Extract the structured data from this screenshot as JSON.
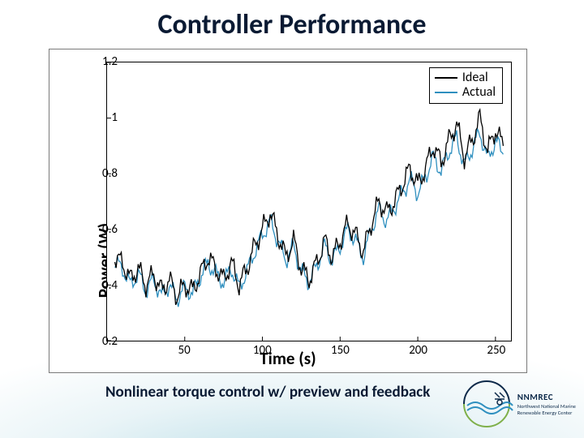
{
  "title": "Controller Performance",
  "subtitle": "Nonlinear torque control w/ preview and feedback",
  "logo": {
    "acronym": "NNMREC",
    "line1": "Northwest National Marine",
    "line2": "Renewable Energy Center"
  },
  "chart_data": {
    "type": "line",
    "xlabel": "Time (s)",
    "ylabel": "Power (W)",
    "xlim": [
      0,
      260
    ],
    "ylim": [
      0.2,
      1.2
    ],
    "xticks": [
      50,
      100,
      150,
      200,
      250
    ],
    "yticks": [
      0.2,
      0.4,
      0.6,
      0.8,
      1.0,
      1.2
    ],
    "legend_position": "top-right",
    "series": [
      {
        "name": "Ideal",
        "color": "#000000",
        "x": [
          5,
          10,
          15,
          20,
          25,
          30,
          35,
          40,
          45,
          50,
          55,
          60,
          65,
          70,
          75,
          80,
          85,
          90,
          95,
          100,
          105,
          110,
          115,
          120,
          125,
          130,
          135,
          140,
          145,
          150,
          155,
          160,
          165,
          170,
          175,
          180,
          185,
          190,
          195,
          200,
          205,
          210,
          215,
          220,
          225,
          230,
          235,
          240,
          245,
          250,
          255
        ],
        "values": [
          0.5,
          0.48,
          0.42,
          0.46,
          0.4,
          0.44,
          0.38,
          0.42,
          0.36,
          0.4,
          0.38,
          0.44,
          0.5,
          0.46,
          0.42,
          0.48,
          0.4,
          0.46,
          0.54,
          0.6,
          0.66,
          0.58,
          0.5,
          0.56,
          0.46,
          0.42,
          0.48,
          0.56,
          0.5,
          0.56,
          0.62,
          0.58,
          0.52,
          0.62,
          0.7,
          0.66,
          0.7,
          0.76,
          0.82,
          0.76,
          0.82,
          0.9,
          0.84,
          0.92,
          0.98,
          0.86,
          0.92,
          1.0,
          0.88,
          0.96,
          0.9
        ]
      },
      {
        "name": "Actual",
        "color": "#2e8fbf",
        "x": [
          5,
          10,
          15,
          20,
          25,
          30,
          35,
          40,
          45,
          50,
          55,
          60,
          65,
          70,
          75,
          80,
          85,
          90,
          95,
          100,
          105,
          110,
          115,
          120,
          125,
          130,
          135,
          140,
          145,
          150,
          155,
          160,
          165,
          170,
          175,
          180,
          185,
          190,
          195,
          200,
          205,
          210,
          215,
          220,
          225,
          230,
          235,
          240,
          245,
          250,
          255
        ],
        "values": [
          0.48,
          0.46,
          0.4,
          0.44,
          0.38,
          0.42,
          0.36,
          0.4,
          0.35,
          0.39,
          0.37,
          0.43,
          0.48,
          0.44,
          0.41,
          0.46,
          0.39,
          0.45,
          0.52,
          0.58,
          0.63,
          0.56,
          0.49,
          0.54,
          0.45,
          0.41,
          0.47,
          0.54,
          0.49,
          0.54,
          0.6,
          0.56,
          0.5,
          0.6,
          0.67,
          0.63,
          0.68,
          0.73,
          0.78,
          0.73,
          0.79,
          0.86,
          0.81,
          0.88,
          0.93,
          0.83,
          0.89,
          0.95,
          0.85,
          0.92,
          0.87
        ]
      }
    ]
  }
}
